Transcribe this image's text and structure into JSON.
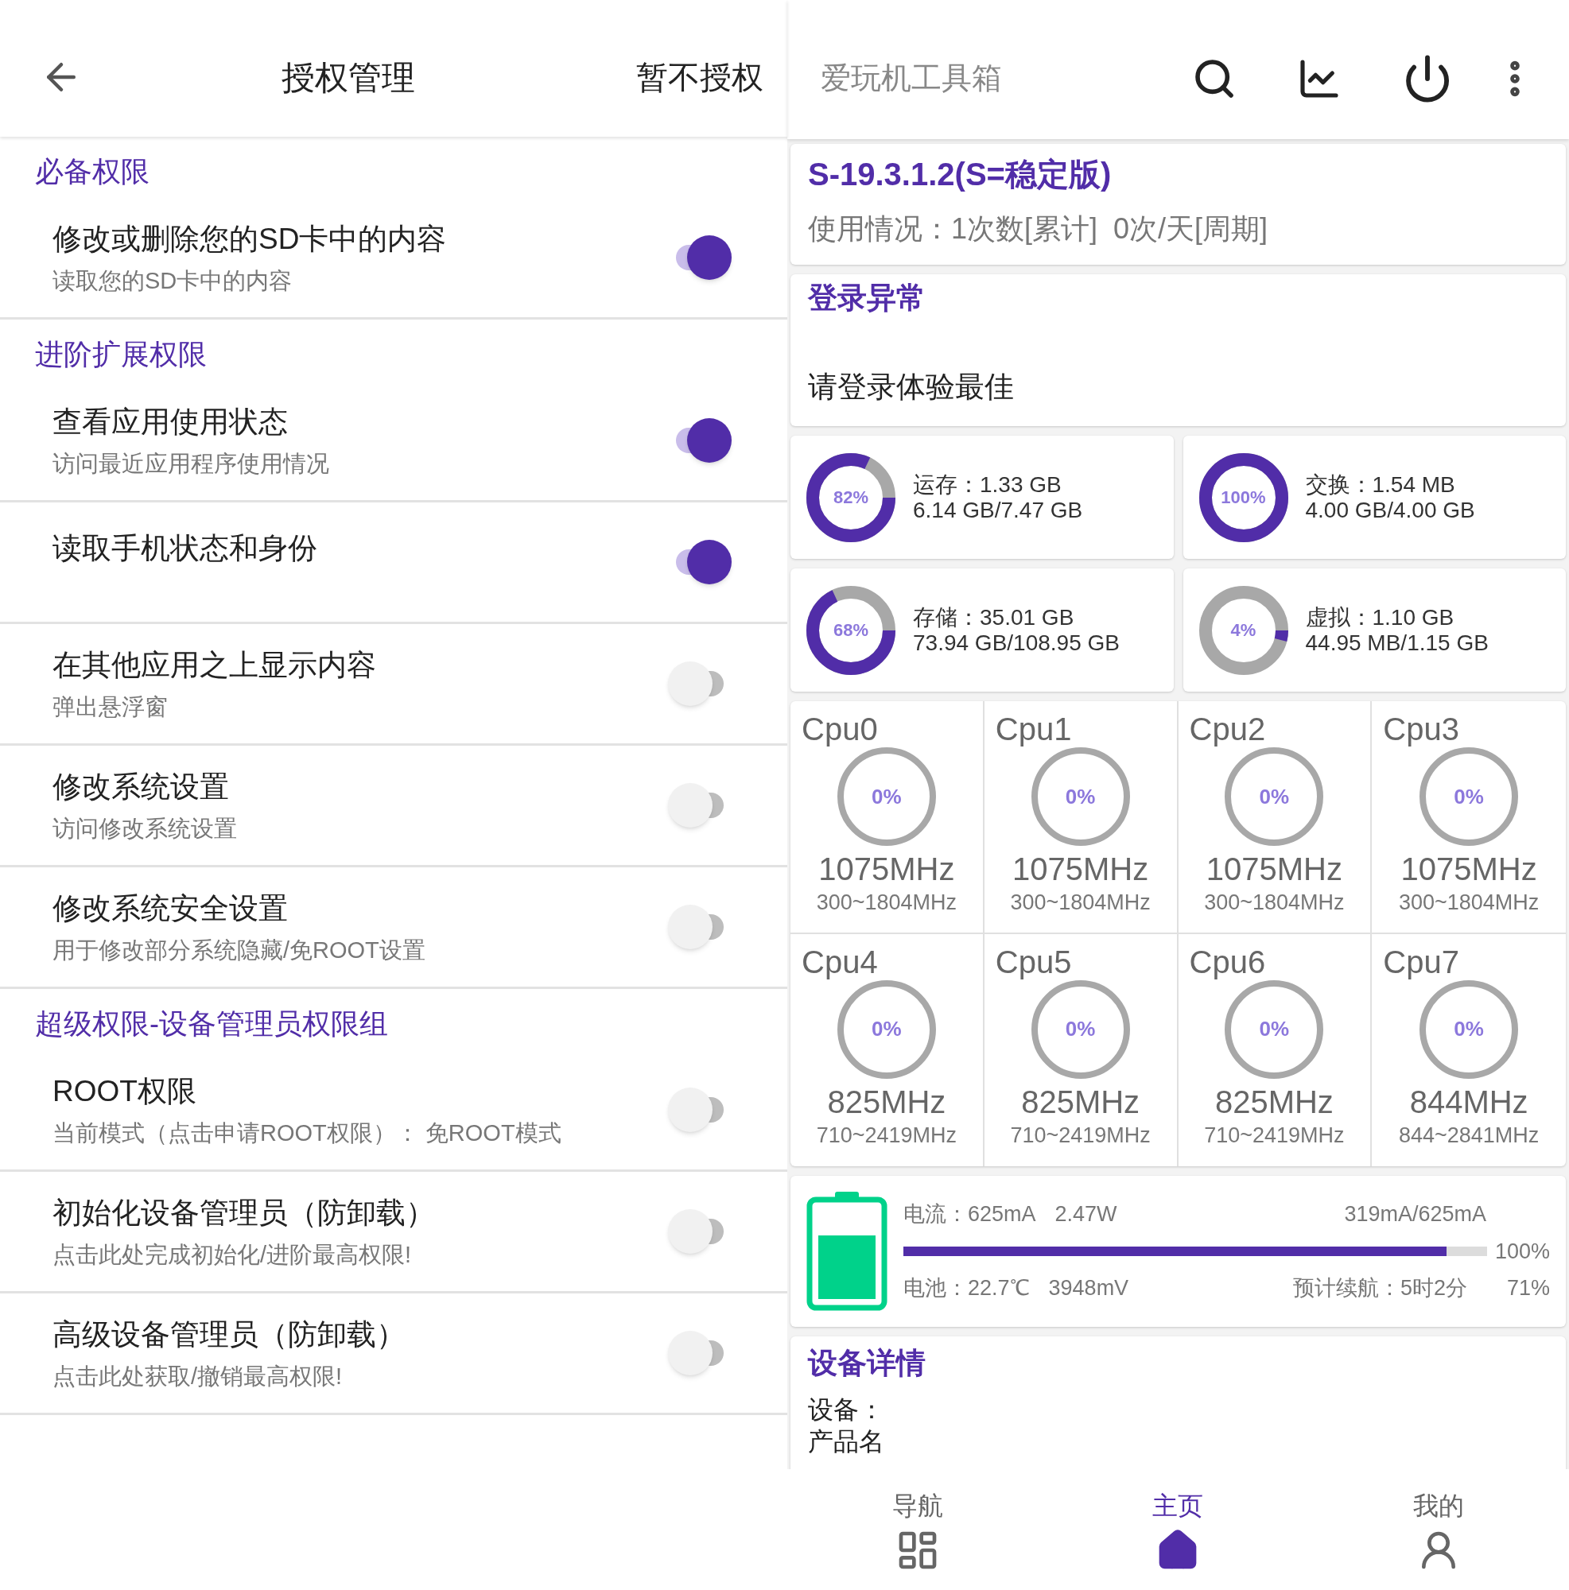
{
  "left": {
    "header": {
      "title": "授权管理",
      "action": "暂不授权"
    },
    "sections": [
      {
        "title": "必备权限",
        "items": [
          {
            "title": "修改或删除您的SD卡中的内容",
            "subtitle": "读取您的SD卡中的内容",
            "on": true
          }
        ]
      },
      {
        "title": "进阶扩展权限",
        "items": [
          {
            "title": "查看应用使用状态",
            "subtitle": "访问最近应用程序使用情况",
            "on": true
          },
          {
            "title": "读取手机状态和身份",
            "on": true
          },
          {
            "title": "在其他应用之上显示内容",
            "subtitle": "弹出悬浮窗",
            "on": false
          },
          {
            "title": "修改系统设置",
            "subtitle": "访问修改系统设置",
            "on": false
          },
          {
            "title": "修改系统安全设置",
            "subtitle": "用于修改部分系统隐藏/免ROOT设置",
            "on": false
          }
        ]
      },
      {
        "title": "超级权限-设备管理员权限组",
        "items": [
          {
            "title": "ROOT权限",
            "subtitle": "当前模式（点击申请ROOT权限）： 免ROOT模式",
            "on": false
          },
          {
            "title": "初始化设备管理员（防卸载）",
            "subtitle": "点击此处完成初始化/进阶最高权限!",
            "on": false
          },
          {
            "title": "高级设备管理员（防卸载）",
            "subtitle": "点击此处获取/撤销最高权限!",
            "on": false
          }
        ]
      }
    ]
  },
  "right": {
    "toolbar": {
      "title": "爱玩机工具箱"
    },
    "version_card": {
      "version": "S-19.3.1.2(S=稳定版)",
      "usage": "使用情况：1次数[累计]  0次/天[周期]"
    },
    "login_card": {
      "title": "登录异常",
      "message": "请登录体验最佳"
    },
    "memory": [
      {
        "percent": "82%",
        "level": 0.82,
        "line1": "运存：1.33 GB",
        "line2": "6.14 GB/7.47 GB"
      },
      {
        "percent": "100%",
        "level": 1,
        "line1": "交换：1.54 MB",
        "line2": "4.00 GB/4.00 GB"
      },
      {
        "percent": "68%",
        "level": 0.68,
        "line1": "存储：35.01 GB",
        "line2": "73.94 GB/108.95 GB"
      },
      {
        "percent": "4%",
        "level": 0.04,
        "line1": "虚拟：1.10 GB",
        "line2": "44.95 MB/1.15 GB"
      }
    ],
    "cpus": [
      {
        "name": "Cpu0",
        "percent": "0%",
        "level": 0,
        "freq": "1075MHz",
        "range": "300~1804MHz"
      },
      {
        "name": "Cpu1",
        "percent": "0%",
        "level": 0,
        "freq": "1075MHz",
        "range": "300~1804MHz"
      },
      {
        "name": "Cpu2",
        "percent": "0%",
        "level": 0,
        "freq": "1075MHz",
        "range": "300~1804MHz"
      },
      {
        "name": "Cpu3",
        "percent": "0%",
        "level": 0,
        "freq": "1075MHz",
        "range": "300~1804MHz"
      },
      {
        "name": "Cpu4",
        "percent": "0%",
        "level": 0,
        "freq": "825MHz",
        "range": "710~2419MHz"
      },
      {
        "name": "Cpu5",
        "percent": "0%",
        "level": 0,
        "freq": "825MHz",
        "range": "710~2419MHz"
      },
      {
        "name": "Cpu6",
        "percent": "0%",
        "level": 0,
        "freq": "825MHz",
        "range": "710~2419MHz"
      },
      {
        "name": "Cpu7",
        "percent": "0%",
        "level": 0,
        "freq": "844MHz",
        "range": "844~2841MHz"
      }
    ],
    "battery": {
      "current": "电流：625mA",
      "power": "2.47W",
      "current_range": "319mA/625mA",
      "level": 0.93,
      "bar_percent": "100%",
      "temperature": "电池：22.7℃",
      "voltage": "3948mV",
      "estimate": "预计续航：5时2分",
      "charge": "71%"
    },
    "device_card": {
      "title": "设备详情",
      "lines": [
        "设备：",
        "产品名"
      ]
    },
    "bottom_nav": [
      {
        "label": "导航",
        "kind": "grid",
        "selected": false
      },
      {
        "label": "主页",
        "kind": "home",
        "selected": true
      },
      {
        "label": "我的",
        "kind": "person",
        "selected": false
      }
    ]
  }
}
